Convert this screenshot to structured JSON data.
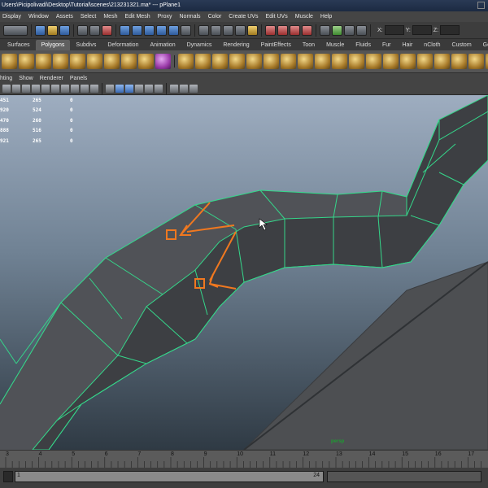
{
  "window": {
    "title": "Users\\Picipolivadi\\Desktop\\Tutorial\\scenes\\213231321.ma*   ---   pPlane1"
  },
  "menubar": {
    "items": [
      "Display",
      "Window",
      "Assets",
      "Select",
      "Mesh",
      "Edit Mesh",
      "Proxy",
      "Normals",
      "Color",
      "Create UVs",
      "Edit UVs",
      "Muscle",
      "Help"
    ]
  },
  "statusline": {
    "x_label": "X:",
    "y_label": "Y:",
    "z_label": "Z:"
  },
  "shelf_tabs": {
    "items": [
      "Surfaces",
      "Polygons",
      "Subdivs",
      "Deformation",
      "Animation",
      "Dynamics",
      "Rendering",
      "PaintEffects",
      "Toon",
      "Muscle",
      "Fluids",
      "Fur",
      "Hair",
      "nCloth",
      "Custom",
      "GoZ"
    ],
    "active": "Polygons"
  },
  "panel_menu": {
    "items": [
      "hting",
      "Show",
      "Renderer",
      "Panels"
    ]
  },
  "hud": {
    "rows": [
      [
        "451",
        "265",
        "0"
      ],
      [
        "920",
        "524",
        "0"
      ],
      [
        "470",
        "260",
        "0"
      ],
      [
        "888",
        "516",
        "0"
      ],
      [
        "921",
        "265",
        "0"
      ]
    ]
  },
  "viewport": {
    "camera_label": "persp",
    "wire_color": "#35d68a",
    "annotation_color": "#f07820"
  },
  "timeslider": {
    "ticks": [
      "3",
      "4",
      "5",
      "6",
      "7",
      "8",
      "9",
      "10",
      "11",
      "12",
      "13",
      "14",
      "15",
      "16",
      "17"
    ]
  },
  "range": {
    "start": "1",
    "end": "24"
  }
}
